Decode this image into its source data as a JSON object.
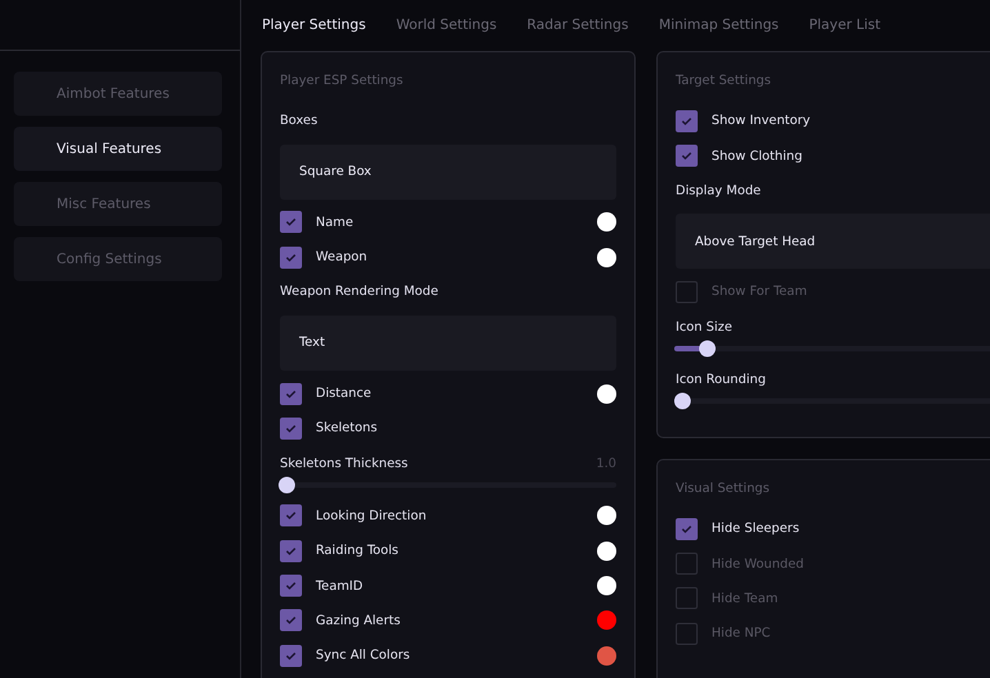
{
  "tabs": [
    {
      "label": "Player Settings",
      "selected": true
    },
    {
      "label": "World Settings",
      "selected": false
    },
    {
      "label": "Radar Settings",
      "selected": false
    },
    {
      "label": "Minimap Settings",
      "selected": false
    },
    {
      "label": "Player List",
      "selected": false
    }
  ],
  "sidebar": {
    "items": [
      {
        "label": "Aimbot Features",
        "selected": false
      },
      {
        "label": "Visual Features",
        "selected": true
      },
      {
        "label": "Misc Features",
        "selected": false
      },
      {
        "label": "Config Settings",
        "selected": false
      }
    ]
  },
  "columns": [
    [
      {
        "title": "Player ESP Settings",
        "items": [
          {
            "kind": "label",
            "label": "Boxes"
          },
          {
            "kind": "dropdown",
            "value": "Square Box"
          },
          {
            "kind": "checkbox",
            "label": "Name",
            "checked": true,
            "color": "#ffffff"
          },
          {
            "kind": "checkbox",
            "label": "Weapon",
            "checked": true,
            "color": "#ffffff"
          },
          {
            "kind": "label",
            "label": "Weapon Rendering Mode"
          },
          {
            "kind": "dropdown",
            "value": "Text"
          },
          {
            "kind": "checkbox",
            "label": "Distance",
            "checked": true,
            "color": "#ffffff"
          },
          {
            "kind": "checkbox",
            "label": "Skeletons",
            "checked": true
          },
          {
            "kind": "slider",
            "label": "Skeletons Thickness",
            "reading": "1.0",
            "level": 0
          },
          {
            "kind": "checkbox",
            "label": "Looking Direction",
            "checked": true,
            "color": "#ffffff"
          },
          {
            "kind": "checkbox",
            "label": "Raiding Tools",
            "checked": true,
            "color": "#ffffff"
          },
          {
            "kind": "checkbox",
            "label": "TeamID",
            "checked": true,
            "color": "#ffffff"
          },
          {
            "kind": "checkbox",
            "label": "Gazing Alerts",
            "checked": true,
            "color": "#ff0000"
          },
          {
            "kind": "checkbox",
            "label": "Sync All Colors",
            "checked": true,
            "color": "#e05545"
          }
        ]
      }
    ],
    [
      {
        "title": "Target Settings",
        "items": [
          {
            "kind": "checkbox",
            "label": "Show Inventory",
            "checked": true
          },
          {
            "kind": "checkbox",
            "label": "Show Clothing",
            "checked": true
          },
          {
            "kind": "label",
            "label": "Display Mode"
          },
          {
            "kind": "dropdown",
            "value": "Above Target Head"
          },
          {
            "kind": "checkbox",
            "label": "Show For Team",
            "checked": false
          },
          {
            "kind": "slider",
            "label": "Icon Size",
            "level": 0.08
          },
          {
            "kind": "slider",
            "label": "Icon Rounding",
            "level": 0
          }
        ]
      },
      {
        "title": "Visual Settings",
        "items": [
          {
            "kind": "checkbox",
            "label": "Hide Sleepers",
            "checked": true
          },
          {
            "kind": "checkbox",
            "label": "Hide Wounded",
            "checked": false
          },
          {
            "kind": "checkbox",
            "label": "Hide Team",
            "checked": false
          },
          {
            "kind": "checkbox",
            "label": "Hide NPC",
            "checked": false
          }
        ]
      }
    ]
  ]
}
